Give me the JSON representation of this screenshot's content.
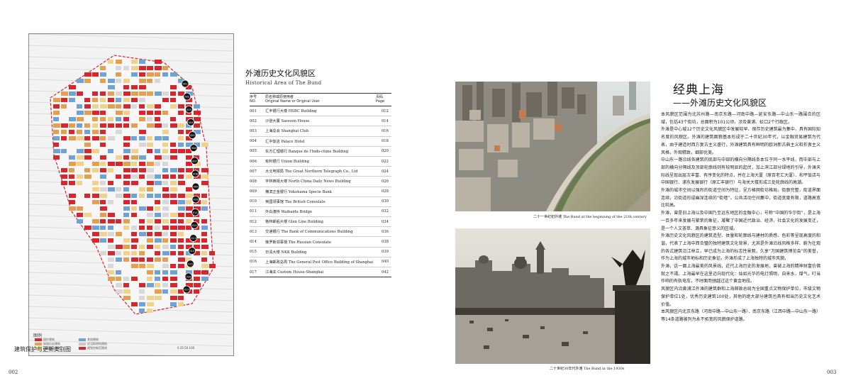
{
  "left_page": {
    "map": {
      "title": "建筑保护与更新类别图",
      "legend_heading": "图例",
      "legend": [
        {
          "label": "保护建筑",
          "color": "#d7262e"
        },
        {
          "label": "保留历史建筑",
          "color": "#e3a04f"
        },
        {
          "label": "一般历史建筑",
          "color": "#f0d28a"
        },
        {
          "label": "其他建筑",
          "color": "#6fa3d6"
        },
        {
          "label": "应当拆除的建筑",
          "color": "#c9c9c9"
        },
        {
          "label": "规划控制范围线",
          "color": "#d7262e"
        }
      ],
      "scale_label": "0  25  50    100",
      "markers": [
        "001",
        "002",
        "003",
        "004",
        "005",
        "006",
        "007",
        "008",
        "009",
        "010",
        "011",
        "012",
        "013",
        "014",
        "015",
        "016",
        "017"
      ],
      "colors": {
        "protected": "#d7262e",
        "retained": "#e3a04f",
        "general": "#f0d28a",
        "other": "#6fa3d6",
        "boundary": "#d7262e"
      }
    },
    "list": {
      "title_cn": "外滩历史文化风貌区",
      "title_en": "Historical Area of The Bund",
      "headers": {
        "no_cn": "序号",
        "no_en": "NO.",
        "name_cn": "原名称或原使用者",
        "name_en": "Original Name or Original User",
        "page_cn": "页码",
        "page_en": "Page"
      },
      "rows": [
        {
          "no": "001",
          "name": "汇丰银行大楼 HSBC Building",
          "page": "012"
        },
        {
          "no": "002",
          "name": "沙逊大厦 Sassoon House",
          "page": "014"
        },
        {
          "no": "003",
          "name": "上海总会 Shanghai Club",
          "page": "016"
        },
        {
          "no": "004",
          "name": "汇中饭店 Palace Hotel",
          "page": "018"
        },
        {
          "no": "005",
          "name": "东方汇理银行 Banque de l'Indo-chine Building",
          "page": "020"
        },
        {
          "no": "006",
          "name": "有利银行 Union Building",
          "page": "022"
        },
        {
          "no": "007",
          "name": "大北电报局 The Great Northern Telegraph Co., Ltd",
          "page": "024"
        },
        {
          "no": "008",
          "name": "字林西报大楼 North China Daily News Building",
          "page": "026"
        },
        {
          "no": "009",
          "name": "横滨正金银行 Yokohama Specie Bank",
          "page": "028"
        },
        {
          "no": "010",
          "name": "英国领事馆 The British Consulate",
          "page": "030"
        },
        {
          "no": "011",
          "name": "外白渡桥 Waibaidu Bridge",
          "page": "032"
        },
        {
          "no": "012",
          "name": "格林邮船大楼 Glen Line Building",
          "page": "034"
        },
        {
          "no": "013",
          "name": "交通银行 The Bank of Communications Building",
          "page": "036"
        },
        {
          "no": "014",
          "name": "俄罗斯领事馆 The Russian Consulate",
          "page": "038"
        },
        {
          "no": "015",
          "name": "日清大楼 NKK Building",
          "page": "039"
        },
        {
          "no": "016",
          "name": "上海邮政总局 The General Post Office Building of Shanghai",
          "page": "040"
        },
        {
          "no": "017",
          "name": "江海关 Custom House-Shanghai",
          "page": "042"
        }
      ]
    },
    "page_number": "002"
  },
  "right_page": {
    "photo_top_caption": "二十一世纪初外滩 The Bund at the beginning of the 21th century",
    "photo_bottom_caption": "二十世纪30年代外滩 The Bund in the 1930s",
    "headline": "经典上海",
    "subhead": "——外滩历史文化风貌区",
    "paragraphs": [
      "本风貌区范围为北苏州路—南京东路—河南中路—延安东路—中山东一路围合的区域，包括43个街坊，总面积为101公顷，涉及黄浦、虹口2个行政区。",
      "外滩是中心城12个历史文化风貌区中发展较早、保存历史建筑最为集中、具有国际知名度的风貌区。外滩的建筑面貌基本形成于二十世纪30年代，以金融贸易建筑为代表，由于建造时西方复古主义盛行，外滩建筑具有鲜明的欧洲新古典主义和折衷主义风格，外观精致，细部优美。",
      "中山东一路沿线各建筑的底部与中部的横向分隔线条本位于同一水平线，而中部与上部的横向分隔线及顶部轮廓线则有较明显的起伏，加上滨江部分绿地的引导，外滩天际线呈现出层次丰富、有序变化的特点，并在上海大厦（原百老汇大厦）、和平饭店与中国银行、浦东发展银行（原汇丰银行）与海关大楼形成三处轮廓线的高潮。",
      "外滩的城市空间以强烈的街道空间为特征，呈方格网街坊格局，街廓完整，街道界面连续，沿街道形成幽深连续的“街墙”，公共活动空间集中，街道宽度有限，道路高宽比较高。",
      "外滩，曾是旧上海以及中国乃至远东地区的金融中心，号称“中国的华尔街”，是上海一百多年来发展与繁荣的象征，凝聚了中国近代政治、经济、社会文化的发展变迁，是一个人文荟萃、源具象征意义的区域。",
      "外滩历史文化风貌区的建筑造型、体量和轮廓线与建材的质感、色彩等呈现高度的和谐，代表了上海中西合璧的独特建筑文化背景，尤其是外滩沿线风格多样、蔚为壮观的各式建筑沿江林立，早已成为上海的标志性景观，久享“万国建筑博览会”的美誉，作为上海的城市地标和历史象征。外滩形成了上海独特的城市风貌。",
      "外滩，这一面上海最美的风景线，近代上海历史的发展地，曾被上海的精神财富仿佛就之不竭。上海最早在这里迈向现代化：灿如光华的电灯照明，自来水，煤气，叮当作响的有轨电车，不时面而驰越过这个黄金地段。",
      "风貌区内沿黄浦江外滩的建筑群和上海邮政总局为全国重点文物保护单位，市级文物保护单位1处，优秀历史建筑100处，其他的绝大部分建筑也具有相当历史文化艺术价值。",
      "本风貌区内北京东路（河南中路—中山东一路）、南京东路（江西中路—中山东一路）等14条道路被列为永不拓宽的风貌保护道路。"
    ],
    "page_number": "003"
  }
}
